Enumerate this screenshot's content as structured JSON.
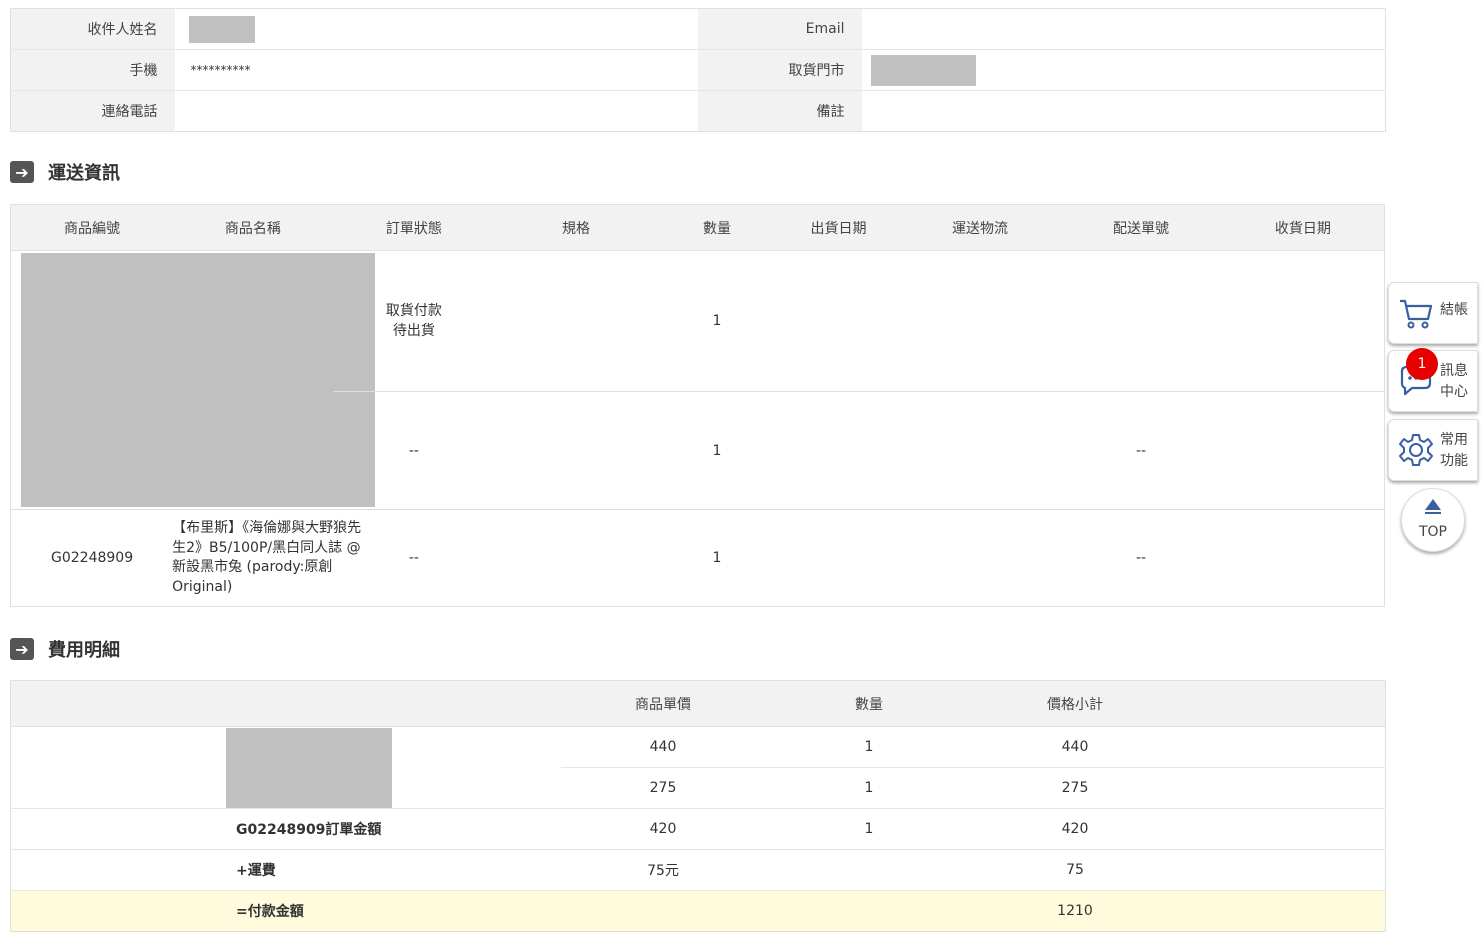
{
  "receiver": {
    "name_label": "收件人姓名",
    "email_label": "Email",
    "phone_label": "手機",
    "phone_value": "**********",
    "store_label": "取貨門市",
    "tel_label": "連絡電話",
    "note_label": "備註"
  },
  "shipping": {
    "title": "運送資訊",
    "headers": [
      "商品編號",
      "商品名稱",
      "訂單狀態",
      "規格",
      "數量",
      "出貨日期",
      "運送物流",
      "配送單號",
      "收貨日期"
    ],
    "rows": [
      {
        "status_line1": "取貨付款",
        "status_line2": "待出貨",
        "qty": "1"
      },
      {
        "status": "--",
        "qty": "1",
        "tracking": "--"
      },
      {
        "code": "G02248909",
        "name": "【布里斯】《海倫娜與大野狼先生2》B5/100P/黑白同人誌 @新設黑市兔 (parody:原創 Original)",
        "status": "--",
        "qty": "1",
        "tracking": "--"
      }
    ]
  },
  "fees": {
    "title": "費用明細",
    "headers": [
      "商品單價",
      "數量",
      "價格小計"
    ],
    "rows": [
      {
        "price": "440",
        "qty": "1",
        "subtotal": "440"
      },
      {
        "price": "275",
        "qty": "1",
        "subtotal": "275"
      },
      {
        "label": "G02248909訂單金額",
        "price": "420",
        "qty": "1",
        "subtotal": "420"
      }
    ],
    "shipping_label": "+運費",
    "shipping_price": "75元",
    "shipping_subtotal": "75",
    "total_label": "=付款金額",
    "total_value": "1210"
  },
  "side": {
    "checkout": "結帳",
    "messages_line1": "訊息",
    "messages_line2": "中心",
    "message_count": "1",
    "common_line1": "常用",
    "common_line2": "功能",
    "top": "TOP"
  },
  "colors": {
    "link": "#3a6db5",
    "badge": "#e60000",
    "total_bg": "#fffbdc"
  }
}
